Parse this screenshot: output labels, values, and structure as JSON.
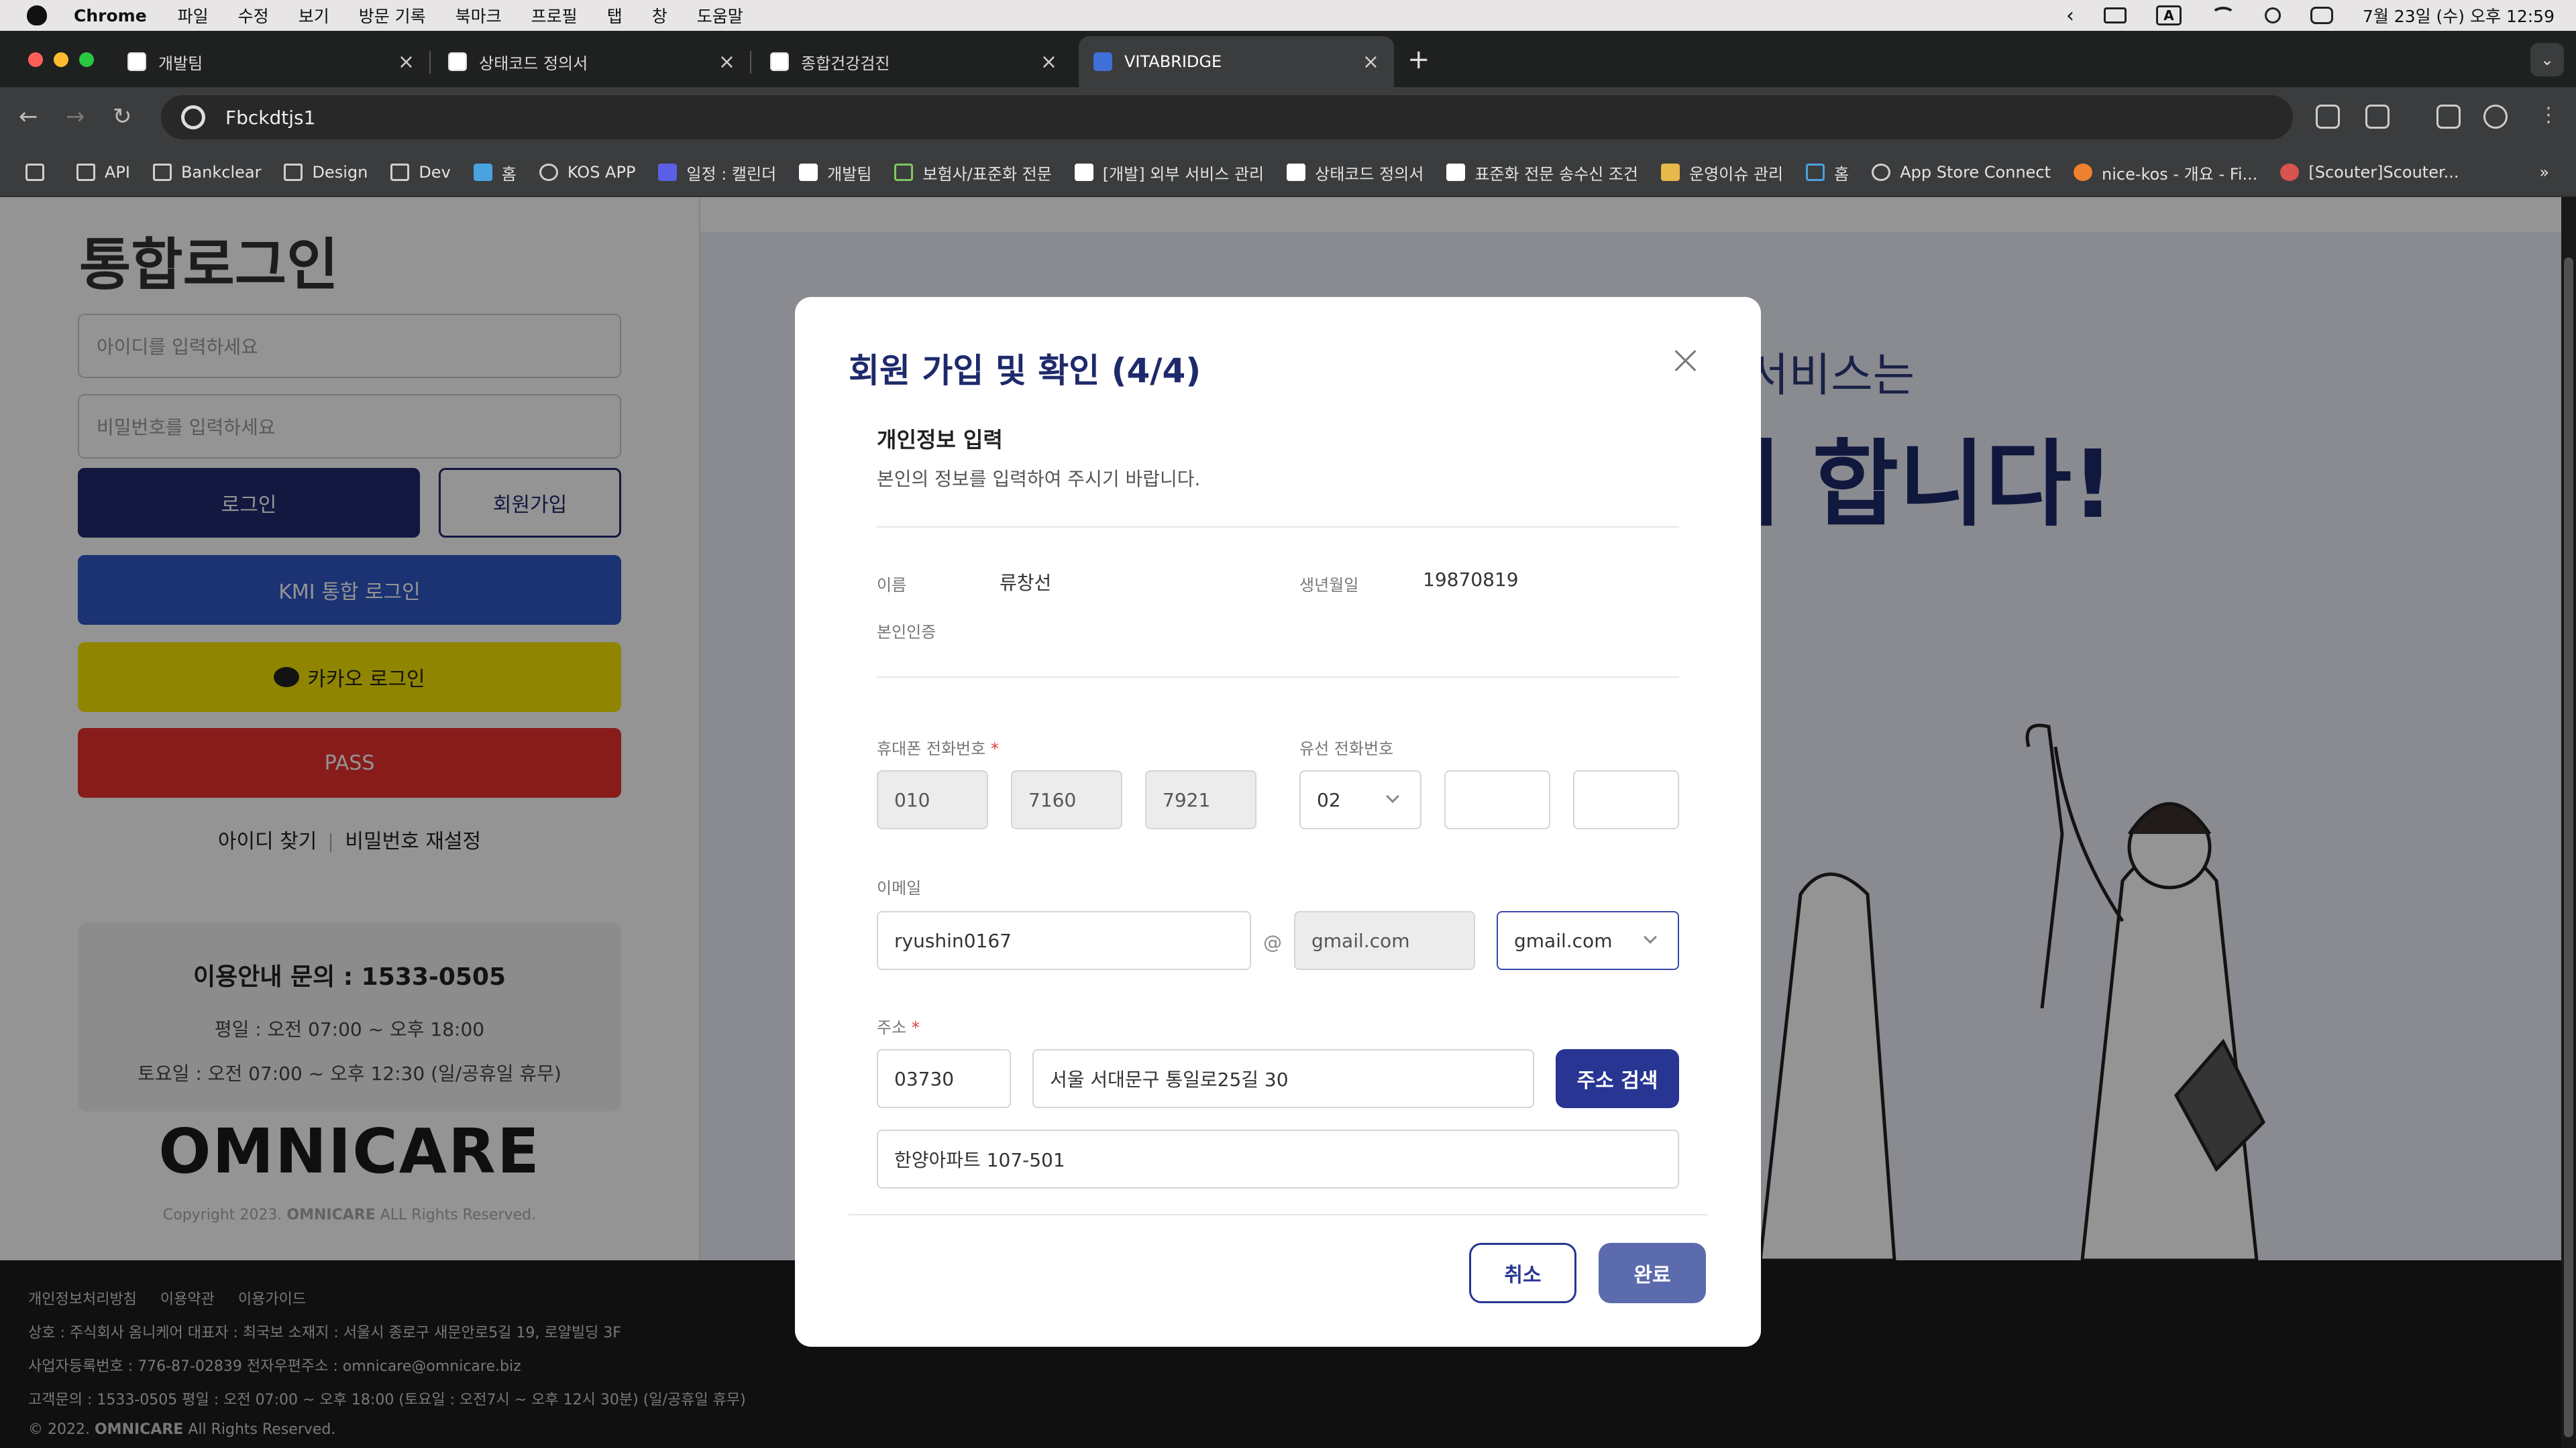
{
  "macbar": {
    "app": "Chrome",
    "menus": [
      "파일",
      "수정",
      "보기",
      "방문 기록",
      "북마크",
      "프로필",
      "탭",
      "창",
      "도움말"
    ],
    "input_badge": "A",
    "datetime": "7월 23일 (수) 오후 12:59"
  },
  "tabs": [
    {
      "title": "개발팀"
    },
    {
      "title": "상태코드 정의서"
    },
    {
      "title": "종합건강검진"
    },
    {
      "title": "VITABRIDGE"
    }
  ],
  "omnibox": {
    "text": "Fbckdtjs1"
  },
  "bookmarks": [
    "API",
    "Bankclear",
    "Design",
    "Dev",
    "홈",
    "KOS APP",
    "일정 : 캘린더",
    "개발팀",
    "보험사/표준화 전문",
    "[개발] 외부 서비스 관리",
    "상태코드 정의서",
    "표준화 전문 송수신 조건",
    "운영이슈 관리",
    "홈",
    "App Store Connect",
    "nice-kos - 개요 - Fi...",
    "[Scouter]Scouter..."
  ],
  "login": {
    "title": "통합로그인",
    "id_placeholder": "아이디를 입력하세요",
    "pw_placeholder": "비밀번호를 입력하세요",
    "login_btn": "로그인",
    "signup_btn": "회원가입",
    "kmi_btn": "KMI 통합 로그인",
    "kakao_btn": "카카오 로그인",
    "pass_btn": "PASS",
    "find_id": "아이디 찾기",
    "reset_pw": "비밀번호 재설정",
    "info_title": "이용안내 문의 : 1533-0505",
    "info_weekday": "평일 : 오전 07:00 ~ 오후 18:00",
    "info_sat": "토요일 : 오전 07:00 ~ 오후 12:30 (일/공휴일 휴무)",
    "logo": "OMNICARE",
    "copyright_pre": "Copyright 2023.",
    "copyright_brand": "OMNICARE",
    "copyright_post": "ALL Rights Reserved."
  },
  "hero": {
    "line1": "서비스는",
    "line2": "게 합니다!"
  },
  "footer": {
    "links": [
      "개인정보처리방침",
      "이용약관",
      "이용가이드"
    ],
    "line1": "상호 : 주식회사 옴니케어 대표자 : 최국보 소재지 : 서울시 종로구 새문안로5길 19, 로얄빌딩 3F",
    "line2": "사업자등록번호 : 776-87-02839 전자우편주소 : omnicare@omnicare.biz",
    "line3": "고객문의 : 1533-0505 평일 : 오전 07:00 ~ 오후 18:00 (토요일 : 오전7시 ~ 오후 12시 30분) (일/공휴일 휴무)",
    "copyright_pre": "© 2022.",
    "copyright_brand": "OMNICARE",
    "copyright_post": "All Rights Reserved."
  },
  "modal": {
    "title": "회원 가입 및 확인 (4/4)",
    "section_title": "개인정보 입력",
    "section_desc": "본인의 정보를 입력하여 주시기 바랍니다.",
    "name_label": "이름",
    "name_value": "류창선",
    "birth_label": "생년월일",
    "birth_value": "19870819",
    "verify_label": "본인인증",
    "mobile_label": "휴대폰 전화번호",
    "mobile": [
      "010",
      "7160",
      "7921"
    ],
    "landline_label": "유선 전화번호",
    "landline_area": "02",
    "landline_mid": "",
    "landline_last": "",
    "email_label": "이메일",
    "email_id": "ryushin0167",
    "email_at": "@",
    "email_domain": "gmail.com",
    "email_domain_select": "gmail.com",
    "address_label": "주소",
    "zipcode": "03730",
    "address1": "서울 서대문구 통일로25길 30",
    "address2": "한양아파트 107-501",
    "search_btn": "주소 검색",
    "cancel_btn": "취소",
    "done_btn": "완료",
    "required_mark": "*"
  },
  "colors": {
    "primary": "#283593",
    "title": "#1e2a6b",
    "kmi": "#2f56c6",
    "kakao": "#f7e600",
    "pass": "#e8312f",
    "login": "#1f2a6f"
  }
}
